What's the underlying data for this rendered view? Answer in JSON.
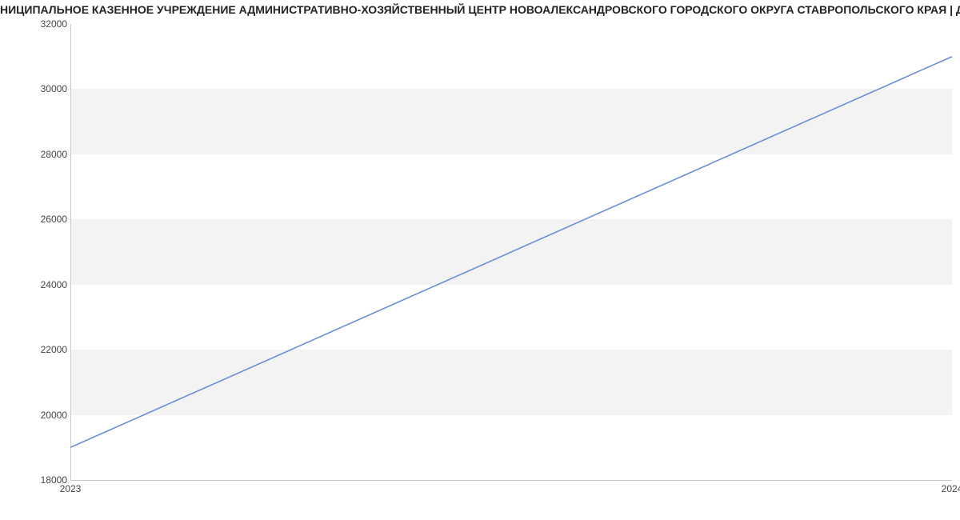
{
  "chart_data": {
    "type": "line",
    "title": "НИЦИПАЛЬНОЕ КАЗЕННОЕ УЧРЕЖДЕНИЕ АДМИНИСТРАТИВНО-ХОЗЯЙСТВЕННЫЙ ЦЕНТР НОВОАЛЕКСАНДРОВСКОГО ГОРОДСКОГО ОКРУГА СТАВРОПОЛЬСКОГО КРАЯ | Дан",
    "x": [
      2023,
      2024
    ],
    "values": [
      19000,
      31000
    ],
    "x_ticks": [
      2023,
      2024
    ],
    "y_ticks": [
      18000,
      20000,
      22000,
      24000,
      26000,
      28000,
      30000,
      32000
    ],
    "xlabel": "",
    "ylabel": "",
    "xlim": [
      2023,
      2024
    ],
    "ylim": [
      18000,
      32000
    ],
    "line_color": "#6a8fd8"
  }
}
